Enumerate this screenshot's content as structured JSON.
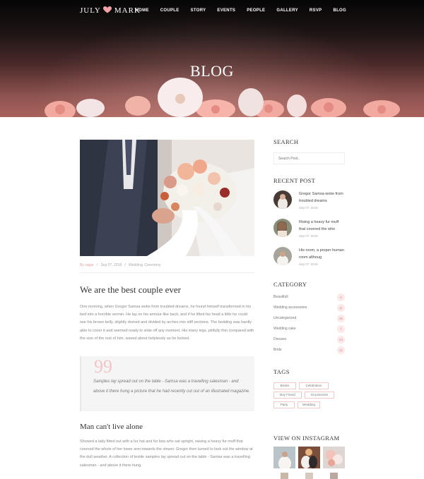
{
  "nav": {
    "logo_left": "JULY",
    "logo_right": "MARK",
    "items": [
      "HOME",
      "COUPLE",
      "STORY",
      "EVENTS",
      "PEOPLE",
      "GALLERY",
      "RSVP",
      "BLOG"
    ]
  },
  "hero": {
    "title": "BLOG"
  },
  "post": {
    "meta_by": "By sagar",
    "meta_sep1": "/",
    "meta_date": "Sep 07, 2018",
    "meta_sep2": "/",
    "meta_cats": "Wedding, Ceremony",
    "title": "We are the best couple ever",
    "body": "One morning, when Gregor Samsa woke from troubled dreams, he found himself transformed in his bed into a horrible vermin. He lay on his armour-like back, and if he lifted his head a little he could see his brown belly, slightly domed and divided by arches into stiff sections. The bedding was hardly able to cover it and seemed ready to slide off any moment. His many legs, pitifully thin compared with the size of the rest of him, waved about helplessly as he looked.",
    "quote_mark": "99",
    "quote": "Samples lay spread out on the table - Samsa was a travelling salesman - and above it there hung a picture that he had recently cut out of an illustrated magazine.",
    "subtitle": "Man can't live alone",
    "body2": "Showed a lady fitted out with a fur hat and fur boa who sat upright, raising a heavy fur muff that covered the whole of her lower arm towards the viewer. Gregor then turned to look out the window at the dull weather. A collection of textile samples lay spread out on the table - Samsa was a travelling salesman - and above it there hung."
  },
  "sidebar": {
    "search_heading": "SEARCH",
    "search_placeholder": "Search Post..",
    "recent_heading": "RECENT POST",
    "recent": [
      {
        "title": "Gregor Samsa woke from troubled dreams",
        "date": "Sep 07, 2018"
      },
      {
        "title": "Rising a heavy fur muff that covered the who",
        "date": "Sep 07, 2018"
      },
      {
        "title": "His room, a proper human room althoug",
        "date": "Sep 07, 2018"
      }
    ],
    "category_heading": "CATEGORY",
    "categories": [
      {
        "label": "Beautifull",
        "count": "5"
      },
      {
        "label": "Wedding accessories",
        "count": "11"
      },
      {
        "label": "Uncategorized",
        "count": "36"
      },
      {
        "label": "Wedding cake",
        "count": "7"
      },
      {
        "label": "Dresses",
        "count": "24"
      },
      {
        "label": "Bride",
        "count": "11"
      }
    ],
    "tags_heading": "TAGS",
    "tags": [
      "Brides",
      "Celebration",
      "Boy Friend",
      "Groomsmen",
      "Party",
      "Wedding"
    ],
    "instagram_heading": "VIEW ON INSTAGRAM"
  },
  "colors": {
    "accent": "#e8a3a3",
    "hero_bottom": "#a9625c"
  }
}
